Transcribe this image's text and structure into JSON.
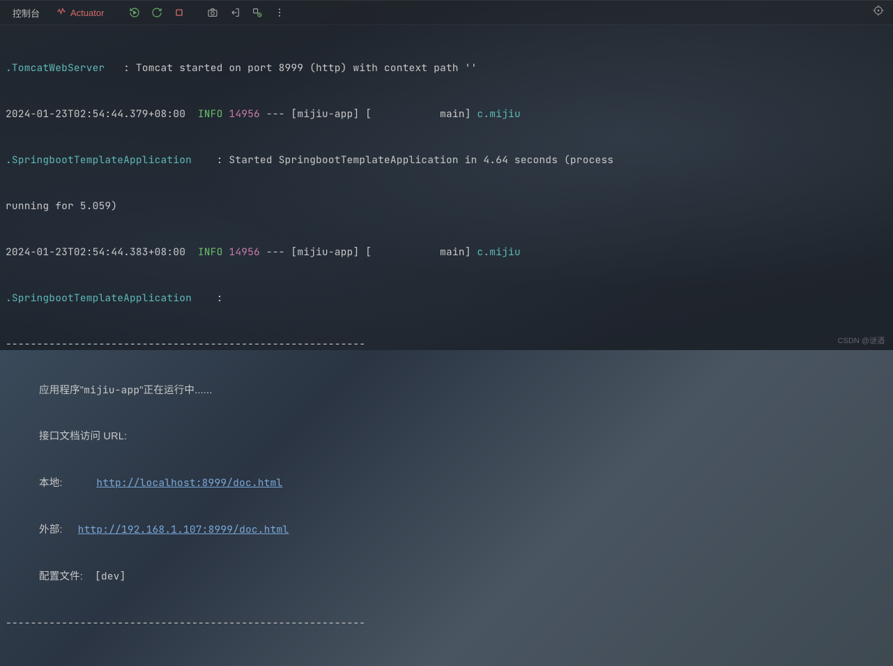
{
  "toolbar": {
    "console_tab": "控制台",
    "actuator_tab": "Actuator"
  },
  "log": {
    "line1_server": ".TomcatWebServer   ",
    "line1_msg": ": Tomcat started on port 8999 (http) with context path ''",
    "line2_ts": "2024-01-23T02:54:44.379+08:00  ",
    "line2_level": "INFO",
    "line2_pid": " 14956",
    "line2_rest": " --- [mijiu-app] [           main] ",
    "line2_logger": "c.mijiu",
    "line3_app": ".SpringbootTemplateApplication    ",
    "line3_msg": ": Started SpringbootTemplateApplication in 4.64 seconds (process",
    "line4": "running for 5.059)",
    "line5_ts": "2024-01-23T02:54:44.383+08:00  ",
    "line5_level": "INFO",
    "line5_pid": " 14956",
    "line5_rest": " --- [mijiu-app] [           main] ",
    "line5_logger": "c.mijiu",
    "line6_app": ".SpringbootTemplateApplication    ",
    "line6_colon": ":",
    "dashes": "----------------------------------------------------------",
    "app_running_cjk1": "应用程序\"",
    "app_running_name": "mijiu-app",
    "app_running_cjk2": "\"正在运行中......",
    "doc_label": "接口文档访问 URL:",
    "local_label": "本地: ",
    "local_url": "http://localhost:8999/doc.html",
    "external_label": "外部: ",
    "external_url": "http://192.168.1.107:8999/doc.html",
    "config_label": "配置文件:    ",
    "config_value": "[dev]"
  },
  "watermark": "CSDN @谜酒"
}
